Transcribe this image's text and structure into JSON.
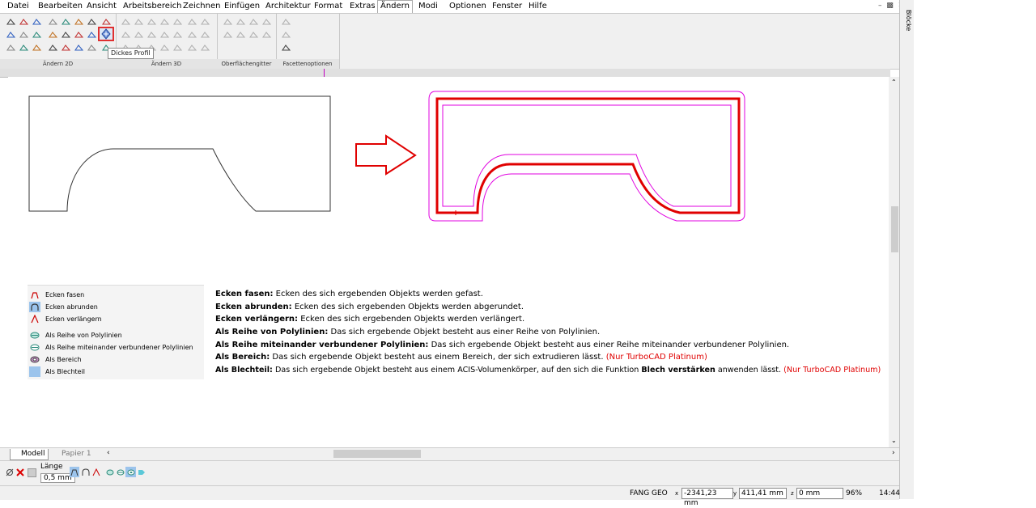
{
  "menu": {
    "items": [
      "Datei",
      "Bearbeiten",
      "Ansicht",
      "Arbeitsbereich",
      "Zeichnen",
      "Einfügen",
      "Architektur",
      "Format",
      "Extras",
      "Ändern",
      "Modi",
      "Optionen",
      "Fenster",
      "Hilfe"
    ],
    "active": "Ändern"
  },
  "ribbon": {
    "groups": [
      "Ändern 2D",
      "Ändern 3D",
      "Oberflächengitter",
      "Facettenoptionen"
    ],
    "tooltip": "Dickes Profil"
  },
  "right_panel": {
    "tab": "Blöcke"
  },
  "legend": {
    "items": [
      {
        "label": "Ecken fasen",
        "icon": "chamfer-corners-icon"
      },
      {
        "label": "Ecken abrunden",
        "icon": "round-corners-icon"
      },
      {
        "label": "Ecken verlängern",
        "icon": "extend-corners-icon"
      },
      {
        "label": "Als Reihe von Polylinien",
        "icon": "polyline-series-icon"
      },
      {
        "label": "Als Reihe miteinander verbundener Polylinien",
        "icon": "connected-polylines-icon"
      },
      {
        "label": "Als Bereich",
        "icon": "region-icon"
      },
      {
        "label": "Als Blechteil",
        "icon": "sheet-metal-icon"
      }
    ]
  },
  "descriptions": [
    {
      "term": "Ecken fasen:",
      "text": " Ecken des sich ergebenden Objekts werden gefast.",
      "bold2": "",
      "text2": "",
      "note": ""
    },
    {
      "term": "Ecken abrunden:",
      "text": " Ecken des sich ergebenden Objekts werden abgerundet.",
      "bold2": "",
      "text2": "",
      "note": ""
    },
    {
      "term": "Ecken verlängern:",
      "text": " Ecken des sich ergebenden Objekts werden verlängert.",
      "bold2": "",
      "text2": "",
      "note": ""
    },
    {
      "term": "Als Reihe von Polylinien:",
      "text": " Das sich ergebende Objekt besteht aus einer Reihe von Polylinien.",
      "bold2": "",
      "text2": "",
      "note": ""
    },
    {
      "term": "Als Reihe miteinander verbundener Polylinien:",
      "text": " Das sich ergebende Objekt besteht aus einer Reihe miteinander verbundener Polylinien.",
      "bold2": "",
      "text2": "",
      "note": ""
    },
    {
      "term": "Als Bereich:",
      "text": " Das sich ergebende Objekt besteht aus einem Bereich, der sich extrudieren lässt. ",
      "bold2": "",
      "text2": "",
      "note": "(Nur TurboCAD Platinum)"
    },
    {
      "term": "Als Blechteil:",
      "text": " Das sich ergebende Objekt besteht aus einem ACIS-Volumenkörper, auf den sich die Funktion ",
      "bold2": "Blech verstärken",
      "text2": " anwenden lässt. ",
      "note": "(Nur TurboCAD Platinum)"
    }
  ],
  "tabs": [
    "Modell",
    "Papier 1"
  ],
  "inspector": {
    "length_label": "Länge",
    "length_value": "0,5 mm"
  },
  "status": {
    "snap1": "FANG",
    "snap2": "GEO",
    "x": "-2341,23 mm",
    "y": "411,41 mm",
    "z": "0 mm",
    "zoom": "96%",
    "time": "14:44"
  },
  "colors": {
    "profile_red": "#e00000",
    "offset_magenta": "#e000e0",
    "accent": "#3070c0"
  }
}
